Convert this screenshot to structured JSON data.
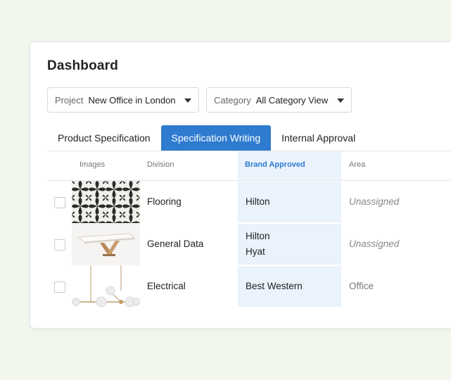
{
  "dashboard": {
    "title": "Dashboard",
    "filters": {
      "project": {
        "label": "Project",
        "value": "New Office in London"
      },
      "category": {
        "label": "Category",
        "value": "All Category View"
      }
    },
    "tabs": [
      {
        "label": "Product Specification",
        "active": false
      },
      {
        "label": "Specification Writing",
        "active": true
      },
      {
        "label": "Internal Approval",
        "active": false
      }
    ],
    "table": {
      "headers": {
        "images": "Images",
        "division": "Division",
        "brand": "Brand Approved",
        "area": "Area"
      },
      "rows": [
        {
          "image": "tile-pattern-image",
          "division": "Flooring",
          "brands": [
            "Hilton"
          ],
          "area": "Unassigned"
        },
        {
          "image": "table-image",
          "division": "General Data",
          "brands": [
            "Hilton",
            "Hyat"
          ],
          "area": "Unassigned"
        },
        {
          "image": "chandelier-image",
          "division": "Electrical",
          "brands": [
            "Best Western"
          ],
          "area": "Office"
        }
      ]
    }
  },
  "colors": {
    "accent": "#2f7bd0",
    "highlight": "#eaf2fc",
    "background": "#f2f7ee"
  }
}
